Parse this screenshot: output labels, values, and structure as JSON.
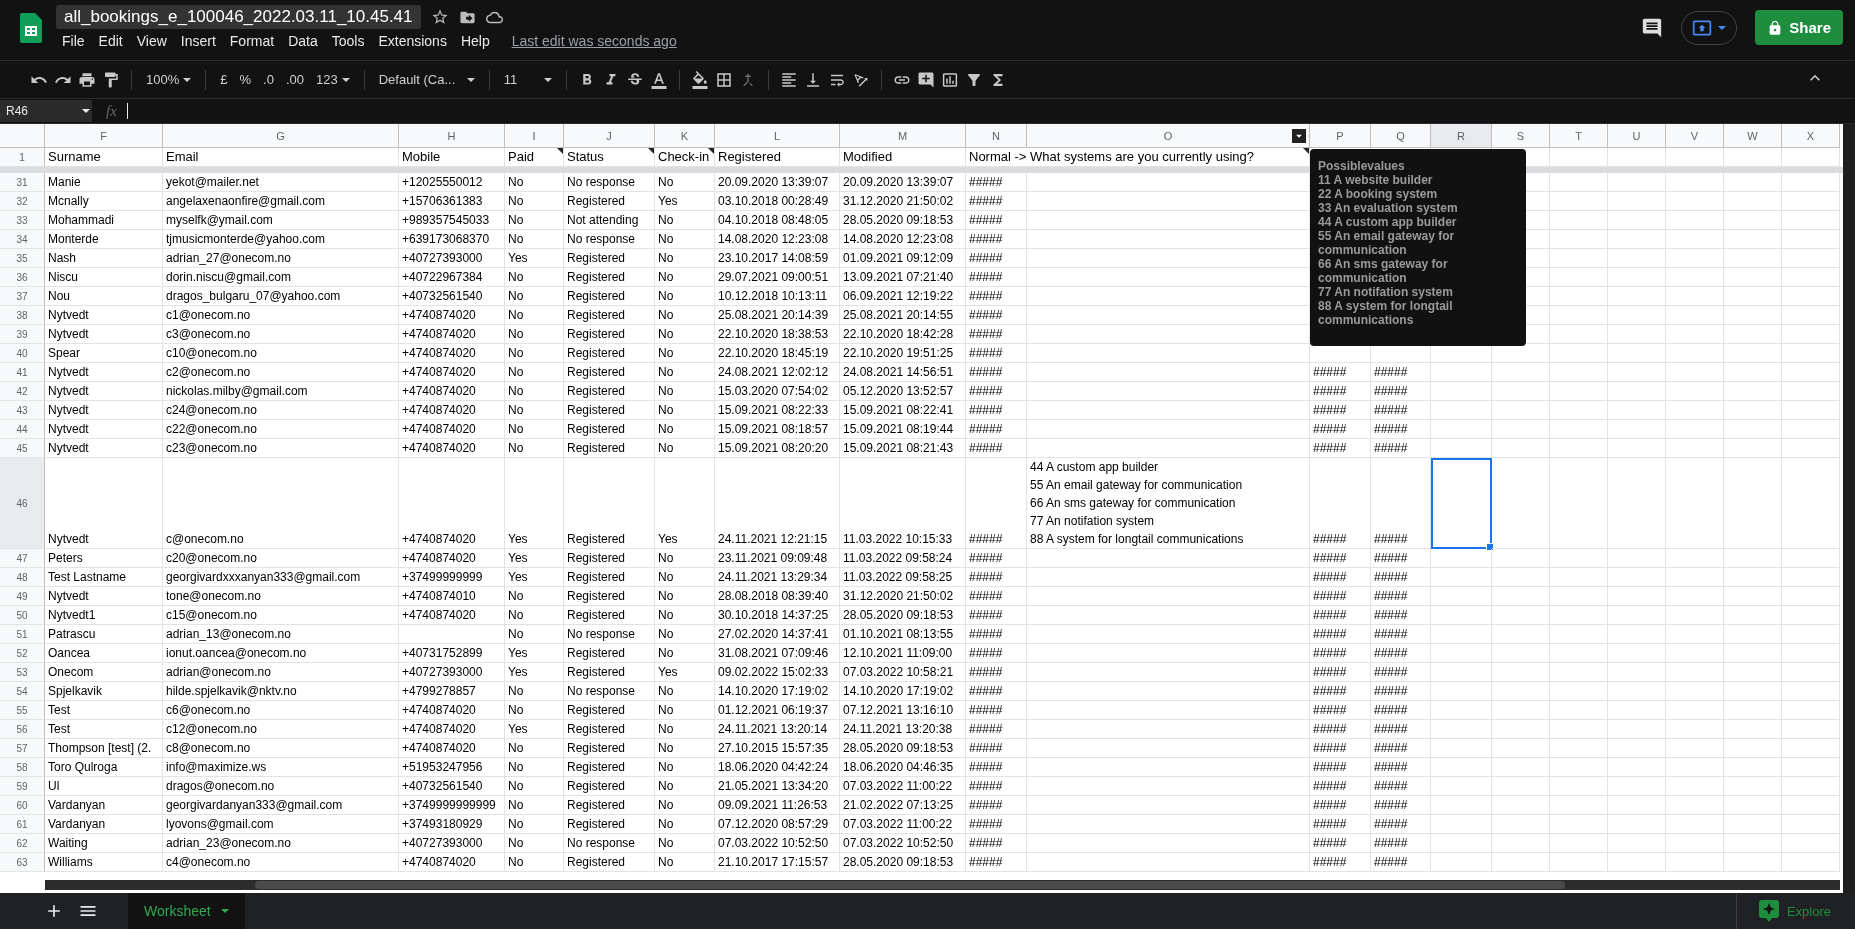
{
  "document": {
    "title": "all_bookings_e_100046_2022.03.11_10.45.41",
    "menu": [
      "File",
      "Edit",
      "View",
      "Insert",
      "Format",
      "Data",
      "Tools",
      "Extensions",
      "Help"
    ],
    "last_edit": "Last edit was seconds ago",
    "share": "Share"
  },
  "toolbar": {
    "zoom": "100%",
    "currency": "£",
    "percent": "%",
    "decrease_decimals": ".0",
    "increase_decimals": ".00",
    "number_format": "123",
    "font": "Default (Ca...",
    "font_size": "11"
  },
  "formula_bar": {
    "name_box": "R46",
    "fx": "fx"
  },
  "columns": [
    {
      "letter": "F",
      "menu": false,
      "selected": false
    },
    {
      "letter": "G",
      "menu": false,
      "selected": false
    },
    {
      "letter": "H",
      "menu": false,
      "selected": false
    },
    {
      "letter": "I",
      "menu": false,
      "selected": false
    },
    {
      "letter": "J",
      "menu": false,
      "selected": false
    },
    {
      "letter": "K",
      "menu": false,
      "selected": false
    },
    {
      "letter": "L",
      "menu": false,
      "selected": false
    },
    {
      "letter": "M",
      "menu": false,
      "selected": false
    },
    {
      "letter": "N",
      "menu": false,
      "selected": false
    },
    {
      "letter": "O",
      "menu": true,
      "selected": false
    },
    {
      "letter": "P",
      "menu": false,
      "selected": false
    },
    {
      "letter": "Q",
      "menu": false,
      "selected": false
    },
    {
      "letter": "R",
      "menu": false,
      "selected": true
    },
    {
      "letter": "S",
      "menu": false,
      "selected": false
    },
    {
      "letter": "T",
      "menu": false,
      "selected": false
    },
    {
      "letter": "U",
      "menu": false,
      "selected": false
    },
    {
      "letter": "V",
      "menu": false,
      "selected": false
    },
    {
      "letter": "W",
      "menu": false,
      "selected": false
    },
    {
      "letter": "X",
      "menu": false,
      "selected": false
    }
  ],
  "header_row": {
    "number": "1",
    "cells": [
      {
        "text": "Surname",
        "note": false
      },
      {
        "text": "Email",
        "note": false
      },
      {
        "text": "Mobile",
        "note": false
      },
      {
        "text": "Paid",
        "note": true
      },
      {
        "text": "Status",
        "note": true
      },
      {
        "text": "Check-in",
        "note": true
      },
      {
        "text": "Registered",
        "note": false
      },
      {
        "text": "Modified",
        "note": false
      },
      {
        "text": "Normal -> What systems are you currently using?",
        "note": false
      },
      {
        "note": true
      }
    ]
  },
  "note_popup": {
    "title": "Possiblevalues",
    "lines": [
      "11 A website builder",
      "22 A booking system",
      "33 An evaluation system",
      "44 A custom app builder",
      "55 An email gateway for communication",
      "66 An sms gateway for communication",
      "77 An notifation system",
      "88 A system for longtail communications"
    ]
  },
  "rows": [
    {
      "number": "31",
      "selected": false,
      "cells": {
        "F": "Manie",
        "G": "yekot@mailer.net",
        "H": "+12025550012",
        "I": "No",
        "J": "No response",
        "K": "No",
        "L": "20.09.2020 13:39:07",
        "M": "20.09.2020 13:39:07",
        "N": "#####"
      }
    },
    {
      "number": "32",
      "selected": false,
      "cells": {
        "F": "Mcnally",
        "G": "angelaxenaonfire@gmail.com",
        "H": "+15706361383",
        "I": "No",
        "J": "Registered",
        "K": "Yes",
        "L": "03.10.2018 00:28:49",
        "M": "31.12.2020 21:50:02",
        "N": "#####"
      }
    },
    {
      "number": "33",
      "selected": false,
      "cells": {
        "F": "Mohammadi",
        "G": "myselfk@ymail.com",
        "H": "+989357545033",
        "I": "No",
        "J": "Not attending",
        "K": "No",
        "L": "04.10.2018 08:48:05",
        "M": "28.05.2020 09:18:53",
        "N": "#####"
      }
    },
    {
      "number": "34",
      "selected": false,
      "cells": {
        "F": "Monterde",
        "G": "tjmusicmonterde@yahoo.com",
        "H": "+639173068370",
        "I": "No",
        "J": "No response",
        "K": "No",
        "L": "14.08.2020 12:23:08",
        "M": "14.08.2020 12:23:08",
        "N": "#####"
      }
    },
    {
      "number": "35",
      "selected": false,
      "cells": {
        "F": "Nash",
        "G": "adrian_27@onecom.no",
        "H": "+40727393000",
        "I": "Yes",
        "J": "Registered",
        "K": "No",
        "L": "23.10.2017 14:08:59",
        "M": "01.09.2021 09:12:09",
        "N": "#####"
      }
    },
    {
      "number": "36",
      "selected": false,
      "cells": {
        "F": "Niscu",
        "G": "dorin.niscu@gmail.com",
        "H": "+40722967384",
        "I": "No",
        "J": "Registered",
        "K": "No",
        "L": "29.07.2021 09:00:51",
        "M": "13.09.2021 07:21:40",
        "N": "#####"
      }
    },
    {
      "number": "37",
      "selected": false,
      "cells": {
        "F": "Nou",
        "G": "dragos_bulgaru_07@yahoo.com",
        "H": "+40732561540",
        "I": "No",
        "J": "Registered",
        "K": "No",
        "L": "10.12.2018 10:13:11",
        "M": "06.09.2021 12:19:22",
        "N": "#####"
      }
    },
    {
      "number": "38",
      "selected": false,
      "cells": {
        "F": "Nytvedt",
        "G": "c1@onecom.no",
        "H": "+4740874020",
        "I": "No",
        "J": "Registered",
        "K": "No",
        "L": "25.08.2021 20:14:39",
        "M": "25.08.2021 20:14:55",
        "N": "#####"
      }
    },
    {
      "number": "39",
      "selected": false,
      "cells": {
        "F": "Nytvedt",
        "G": "c3@onecom.no",
        "H": "+4740874020",
        "I": "No",
        "J": "Registered",
        "K": "No",
        "L": "22.10.2020 18:38:53",
        "M": "22.10.2020 18:42:28",
        "N": "#####"
      }
    },
    {
      "number": "40",
      "selected": false,
      "cells": {
        "F": "Spear",
        "G": "c10@onecom.no",
        "H": "+4740874020",
        "I": "No",
        "J": "Registered",
        "K": "No",
        "L": "22.10.2020 18:45:19",
        "M": "22.10.2020 19:51:25",
        "N": "#####"
      }
    },
    {
      "number": "41",
      "selected": false,
      "cells": {
        "F": "Nytvedt",
        "G": "c2@onecom.no",
        "H": "+4740874020",
        "I": "No",
        "J": "Registered",
        "K": "No",
        "L": "24.08.2021 12:02:12",
        "M": "24.08.2021 14:56:51",
        "N": "#####",
        "P": "#####",
        "Q": "#####"
      }
    },
    {
      "number": "42",
      "selected": false,
      "cells": {
        "F": "Nytvedt",
        "G": "nickolas.milby@gmail.com",
        "H": "+4740874020",
        "I": "No",
        "J": "Registered",
        "K": "No",
        "L": "15.03.2020 07:54:02",
        "M": "05.12.2020 13:52:57",
        "N": "#####",
        "P": "#####",
        "Q": "#####"
      }
    },
    {
      "number": "43",
      "selected": false,
      "cells": {
        "F": "Nytvedt",
        "G": "c24@onecom.no",
        "H": "+4740874020",
        "I": "No",
        "J": "Registered",
        "K": "No",
        "L": "15.09.2021 08:22:33",
        "M": "15.09.2021 08:22:41",
        "N": "#####",
        "P": "#####",
        "Q": "#####"
      }
    },
    {
      "number": "44",
      "selected": false,
      "cells": {
        "F": "Nytvedt",
        "G": "c22@onecom.no",
        "H": "+4740874020",
        "I": "No",
        "J": "Registered",
        "K": "No",
        "L": "15.09.2021 08:18:57",
        "M": "15.09.2021 08:19:44",
        "N": "#####",
        "P": "#####",
        "Q": "#####"
      }
    },
    {
      "number": "45",
      "selected": false,
      "cells": {
        "F": "Nytvedt",
        "G": "c23@onecom.no",
        "H": "+4740874020",
        "I": "No",
        "J": "Registered",
        "K": "No",
        "L": "15.09.2021 08:20:20",
        "M": "15.09.2021 08:21:43",
        "N": "#####",
        "P": "#####",
        "Q": "#####"
      }
    },
    {
      "number": "46",
      "selected": true,
      "cells": {
        "F": "Nytvedt",
        "G": "c@onecom.no",
        "H": "+4740874020",
        "I": "Yes",
        "J": "Registered",
        "K": "Yes",
        "L": "24.11.2021 12:21:15",
        "M": "11.03.2022 10:15:33",
        "N": "#####",
        "O": "44 A custom app builder\n55 An email gateway for communication\n66 An sms gateway for communication\n77 An notifation system\n88 A system for longtail communications",
        "P": "#####",
        "Q": "#####"
      }
    },
    {
      "number": "47",
      "selected": false,
      "cells": {
        "F": "Peters",
        "G": "c20@onecom.no",
        "H": "+4740874020",
        "I": "Yes",
        "J": "Registered",
        "K": "No",
        "L": "23.11.2021 09:09:48",
        "M": "11.03.2022 09:58:24",
        "N": "#####",
        "P": "#####",
        "Q": "#####"
      }
    },
    {
      "number": "48",
      "selected": false,
      "cells": {
        "F": "Test Lastname",
        "G": "georgivardxxxanyan333@gmail.com",
        "H": "+37499999999",
        "I": "Yes",
        "J": "Registered",
        "K": "No",
        "L": "24.11.2021 13:29:34",
        "M": "11.03.2022 09:58:25",
        "N": "#####",
        "P": "#####",
        "Q": "#####"
      }
    },
    {
      "number": "49",
      "selected": false,
      "cells": {
        "F": "Nytvedt",
        "G": "tone@onecom.no",
        "H": "+4740874010",
        "I": "No",
        "J": "Registered",
        "K": "No",
        "L": "28.08.2018 08:39:40",
        "M": "31.12.2020 21:50:02",
        "N": "#####",
        "P": "#####",
        "Q": "#####"
      }
    },
    {
      "number": "50",
      "selected": false,
      "cells": {
        "F": "Nytvedt1",
        "G": "c15@onecom.no",
        "H": "+4740874020",
        "I": "No",
        "J": "Registered",
        "K": "No",
        "L": "30.10.2018 14:37:25",
        "M": "28.05.2020 09:18:53",
        "N": "#####",
        "P": "#####",
        "Q": "#####"
      }
    },
    {
      "number": "51",
      "selected": false,
      "cells": {
        "F": "Patrascu",
        "G": "adrian_13@onecom.no",
        "I": "No",
        "J": "No response",
        "K": "No",
        "L": "27.02.2020 14:37:41",
        "M": "01.10.2021 08:13:55",
        "N": "#####",
        "P": "#####",
        "Q": "#####"
      }
    },
    {
      "number": "52",
      "selected": false,
      "cells": {
        "F": "Oancea",
        "G": "ionut.oancea@onecom.no",
        "H": "+40731752899",
        "I": "Yes",
        "J": "Registered",
        "K": "No",
        "L": "31.08.2021 07:09:46",
        "M": "12.10.2021 11:09:00",
        "N": "#####",
        "P": "#####",
        "Q": "#####"
      }
    },
    {
      "number": "53",
      "selected": false,
      "cells": {
        "F": "Onecom",
        "G": "adrian@onecom.no",
        "H": "+40727393000",
        "I": "Yes",
        "J": "Registered",
        "K": "Yes",
        "L": "09.02.2022 15:02:33",
        "M": "07.03.2022 10:58:21",
        "N": "#####",
        "P": "#####",
        "Q": "#####"
      }
    },
    {
      "number": "54",
      "selected": false,
      "cells": {
        "F": "Spjelkavik",
        "G": "hilde.spjelkavik@nktv.no",
        "H": "+4799278857",
        "I": "No",
        "J": "No response",
        "K": "No",
        "L": "14.10.2020 17:19:02",
        "M": "14.10.2020 17:19:02",
        "N": "#####",
        "P": "#####",
        "Q": "#####"
      }
    },
    {
      "number": "55",
      "selected": false,
      "cells": {
        "F": "Test",
        "G": "c6@onecom.no",
        "H": "+4740874020",
        "I": "No",
        "J": "Registered",
        "K": "No",
        "L": "01.12.2021 06:19:37",
        "M": "07.12.2021 13:16:10",
        "N": "#####",
        "P": "#####",
        "Q": "#####"
      }
    },
    {
      "number": "56",
      "selected": false,
      "cells": {
        "F": "Test",
        "G": "c12@onecom.no",
        "H": "+4740874020",
        "I": "Yes",
        "J": "Registered",
        "K": "No",
        "L": "24.11.2021 13:20:14",
        "M": "24.11.2021 13:20:38",
        "N": "#####",
        "P": "#####",
        "Q": "#####"
      }
    },
    {
      "number": "57",
      "selected": false,
      "cells": {
        "F": "Thompson [test] (2.",
        "G": "c8@onecom.no",
        "H": "+4740874020",
        "I": "No",
        "J": "Registered",
        "K": "No",
        "L": "27.10.2015 15:57:35",
        "M": "28.05.2020 09:18:53",
        "N": "#####",
        "P": "#####",
        "Q": "#####"
      }
    },
    {
      "number": "58",
      "selected": false,
      "cells": {
        "F": "Toro Qulroga",
        "G": "info@maximize.ws",
        "H": "+51953247956",
        "I": "No",
        "J": "Registered",
        "K": "No",
        "L": "18.06.2020 04:42:24",
        "M": "18.06.2020 04:46:35",
        "N": "#####",
        "P": "#####",
        "Q": "#####"
      }
    },
    {
      "number": "59",
      "selected": false,
      "cells": {
        "F": "Ul",
        "G": "dragos@onecom.no",
        "H": "+40732561540",
        "I": "No",
        "J": "Registered",
        "K": "No",
        "L": "21.05.2021 13:34:20",
        "M": "07.03.2022 11:00:22",
        "N": "#####",
        "P": "#####",
        "Q": "#####"
      }
    },
    {
      "number": "60",
      "selected": false,
      "cells": {
        "F": "Vardanyan",
        "G": "georgivardanyan333@gmail.com",
        "H": "+3749999999999",
        "I": "No",
        "J": "Registered",
        "K": "No",
        "L": "09.09.2021 11:26:53",
        "M": "21.02.2022 07:13:25",
        "N": "#####",
        "P": "#####",
        "Q": "#####"
      }
    },
    {
      "number": "61",
      "selected": false,
      "cells": {
        "F": "Vardanyan",
        "G": "lyovons@gmail.com",
        "H": "+37493180929",
        "I": "No",
        "J": "Registered",
        "K": "No",
        "L": "07.12.2020 08:57:29",
        "M": "07.03.2022 11:00:22",
        "N": "#####",
        "P": "#####",
        "Q": "#####"
      }
    },
    {
      "number": "62",
      "selected": false,
      "cells": {
        "F": "Waiting",
        "G": "adrian_23@onecom.no",
        "H": "+40727393000",
        "I": "No",
        "J": "No response",
        "K": "No",
        "L": "07.03.2022 10:52:50",
        "M": "07.03.2022 10:52:50",
        "N": "#####",
        "P": "#####",
        "Q": "#####"
      }
    },
    {
      "number": "63",
      "selected": false,
      "cells": {
        "F": "Williams",
        "G": "c4@onecom.no",
        "H": "+4740874020",
        "I": "No",
        "J": "Registered",
        "K": "No",
        "L": "21.10.2017 17:15:57",
        "M": "28.05.2020 09:18:53",
        "N": "#####",
        "P": "#####",
        "Q": "#####"
      }
    }
  ],
  "sheet_tabs": [
    {
      "label": "Worksheet",
      "selected": true
    }
  ],
  "explore": "Explore"
}
